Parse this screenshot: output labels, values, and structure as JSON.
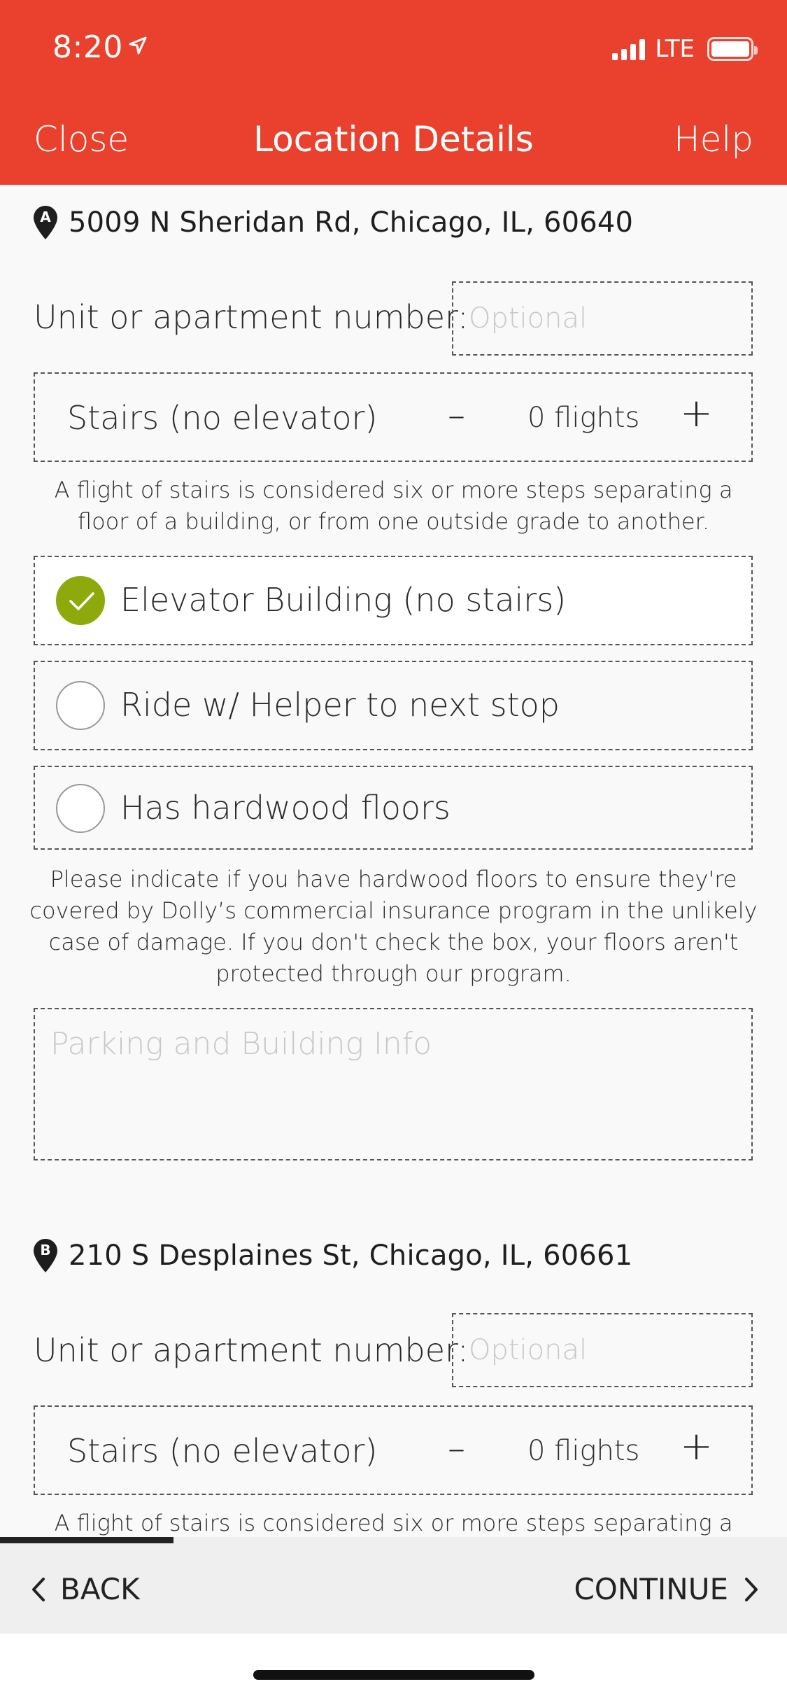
{
  "status_bar": {
    "time": "8:20",
    "network": "LTE"
  },
  "nav": {
    "close": "Close",
    "title": "Location Details",
    "help": "Help"
  },
  "stop_a": {
    "marker": "A",
    "address": "5009 N Sheridan Rd, Chicago, IL, 60640",
    "unit_label": "Unit or apartment number:",
    "unit_placeholder": "Optional",
    "unit_value": "",
    "stairs_label": "Stairs (no elevator)",
    "stairs_minus": "–",
    "stairs_value": "0 flights",
    "stairs_plus": "+",
    "stairs_note": "A flight of stairs is considered six or more steps separating a floor of a building, or from one outside grade to another.",
    "options": [
      {
        "label": "Elevator Building (no stairs)",
        "checked": true
      },
      {
        "label": "Ride w/ Helper to next stop",
        "checked": false
      },
      {
        "label": "Has hardwood floors",
        "checked": false
      }
    ],
    "hardwood_note": "Please indicate if you have hardwood floors to ensure they're covered by Dolly’s commercial insurance program in the unlikely case of damage. If you don't check the box, your floors aren't protected through our program.",
    "parking_placeholder": "Parking and Building Info"
  },
  "stop_b": {
    "marker": "B",
    "address": "210 S Desplaines St, Chicago, IL, 60661",
    "unit_label": "Unit or apartment number:",
    "unit_placeholder": "Optional",
    "unit_value": "",
    "stairs_label": "Stairs (no elevator)",
    "stairs_minus": "–",
    "stairs_value": "0 flights",
    "stairs_plus": "+",
    "stairs_note": "A flight of stairs is considered six or more steps separating a floor of a building, or from one outside grade to another."
  },
  "footer": {
    "back": "BACK",
    "continue": "CONTINUE",
    "progress_fraction": 0.22
  },
  "colors": {
    "header": "#e9412d",
    "check": "#8ea90c",
    "footer": "#efefef"
  },
  "icons": [
    "location-arrow-icon",
    "signal-icon",
    "battery-icon",
    "map-pin-icon",
    "check-icon",
    "chevron-left-icon",
    "chevron-right-icon"
  ]
}
